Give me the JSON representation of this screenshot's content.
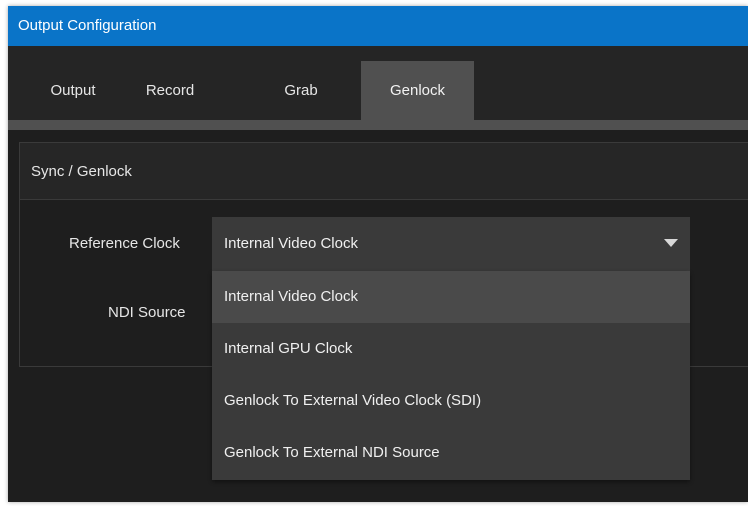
{
  "window": {
    "title": "Output Configuration"
  },
  "tabs": [
    {
      "label": "Output",
      "active": false
    },
    {
      "label": "Record",
      "active": false
    },
    {
      "label": "Grab",
      "active": false
    },
    {
      "label": "Genlock",
      "active": true
    }
  ],
  "group": {
    "title": "Sync / Genlock"
  },
  "reference_clock": {
    "label": "Reference Clock",
    "selected": "Internal Video Clock",
    "options": [
      "Internal Video Clock",
      "Internal GPU Clock",
      "Genlock To External Video Clock (SDI)",
      "Genlock To External NDI Source"
    ]
  },
  "ndi_source": {
    "label": "NDI Source"
  },
  "colors": {
    "titlebar": "#0a74c8",
    "background": "#1e1e1e",
    "tab_active": "#505050",
    "dropdown": "#3a3a3a",
    "highlight": "#4a4a4a"
  }
}
